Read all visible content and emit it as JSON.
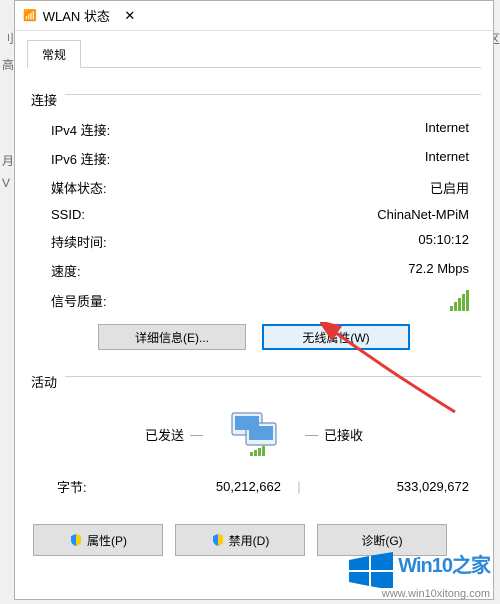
{
  "window": {
    "title": "WLAN 状态",
    "close_glyph": "✕"
  },
  "tabs": {
    "active": "常规"
  },
  "connection": {
    "title": "连接",
    "rows": {
      "ipv4_label": "IPv4 连接:",
      "ipv4_value": "Internet",
      "ipv6_label": "IPv6 连接:",
      "ipv6_value": "Internet",
      "media_label": "媒体状态:",
      "media_value": "已启用",
      "ssid_label": "SSID:",
      "ssid_value": "ChinaNet-MPiM",
      "duration_label": "持续时间:",
      "duration_value": "05:10:12",
      "speed_label": "速度:",
      "speed_value": "72.2 Mbps",
      "signal_label": "信号质量:"
    },
    "buttons": {
      "details": "详细信息(E)...",
      "wireless_props": "无线属性(W)"
    }
  },
  "activity": {
    "title": "活动",
    "sent_label": "已发送",
    "received_label": "已接收",
    "bytes_label": "字节:",
    "bytes_sent": "50,212,662",
    "bytes_received": "533,029,672"
  },
  "bottom": {
    "properties": "属性(P)",
    "disable": "禁用(D)",
    "diagnose": "诊断(G)"
  },
  "watermark": {
    "brand": "Win10之家",
    "url": "www.win10xitong.com"
  },
  "edges": {
    "e1": "刂",
    "e2": "高",
    "e3": "月",
    "e4": "V",
    "e5": "\"区"
  }
}
